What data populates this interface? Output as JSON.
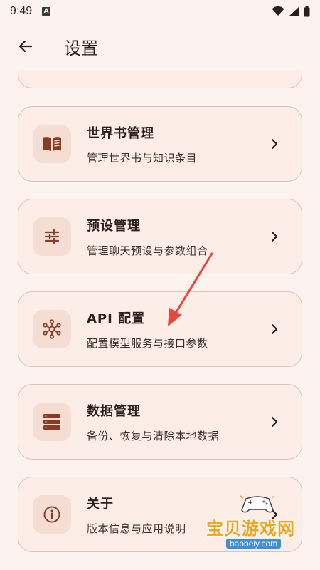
{
  "status_bar": {
    "time": "9:49",
    "notification_badge": "A",
    "icons": [
      "wifi-icon",
      "signal-icon",
      "battery-icon"
    ]
  },
  "header": {
    "back_icon": "arrow-left-icon",
    "title": "设置"
  },
  "settings": {
    "items": [
      {
        "title": "世界书管理",
        "subtitle": "管理世界书与知识条目",
        "icon": "book-icon"
      },
      {
        "title": "预设管理",
        "subtitle": "管理聊天预设与参数组合",
        "icon": "sliders-icon"
      },
      {
        "title": "API 配置",
        "subtitle": "配置模型服务与接口参数",
        "icon": "network-hub-icon"
      },
      {
        "title": "数据管理",
        "subtitle": "备份、恢复与清除本地数据",
        "icon": "storage-icon"
      },
      {
        "title": "关于",
        "subtitle": "版本信息与应用说明",
        "icon": "info-icon"
      }
    ]
  },
  "watermark": {
    "text": "宝贝游戏网",
    "url": "baobeiy.com"
  },
  "colors": {
    "background": "#fcf3ee",
    "card": "#fcede7",
    "card_border": "#d9c4bd",
    "icon_box": "#f6ddd4",
    "icon": "#8a3c22",
    "annotation_arrow": "#e8473a"
  }
}
